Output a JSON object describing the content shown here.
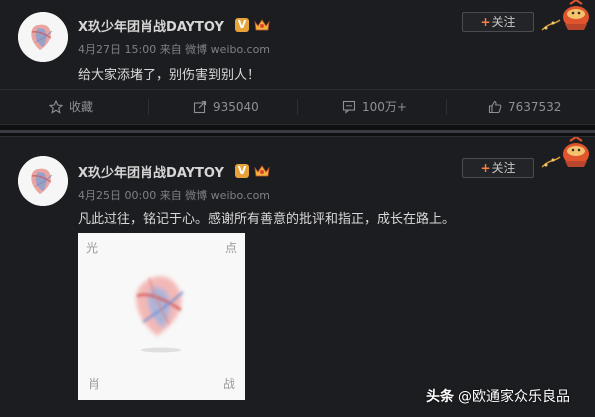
{
  "colors": {
    "background": "#1c1d20",
    "text_primary": "#d9d9d9",
    "text_meta": "#7e8085",
    "follow_plus": "#ff8140",
    "verified_badge": "#e8a23a"
  },
  "icons": {
    "collect": "star-icon",
    "repost": "repost-icon",
    "comment": "comment-icon",
    "like": "thumbs-up-icon",
    "verified": "verified-v-icon",
    "vip": "crown-icon"
  },
  "posts": [
    {
      "username": "X玖少年团肖战DAYTOY",
      "verified_mark": "V",
      "meta": "4月27日 15:00 来自 微博 weibo.com",
      "content": "给大家添堵了，别伤害到别人！",
      "follow_label": "关注",
      "follow_plus": "+",
      "actions": {
        "collect": "收藏",
        "repost": "935040",
        "comment": "100万+",
        "like": "7637532"
      }
    },
    {
      "username": "X玖少年团肖战DAYTOY",
      "verified_mark": "V",
      "meta": "4月25日 00:00 来自 微博 weibo.com",
      "content": "凡此过往，铭记于心。感谢所有善意的批评和指正，成长在路上。",
      "follow_label": "关注",
      "follow_plus": "+",
      "image_corners": {
        "top_left": "光",
        "top_right": "点",
        "bottom_left": "肖",
        "bottom_right": "战"
      }
    }
  ],
  "watermark": {
    "brand": "头条",
    "account": "@欧通家众乐良品"
  }
}
